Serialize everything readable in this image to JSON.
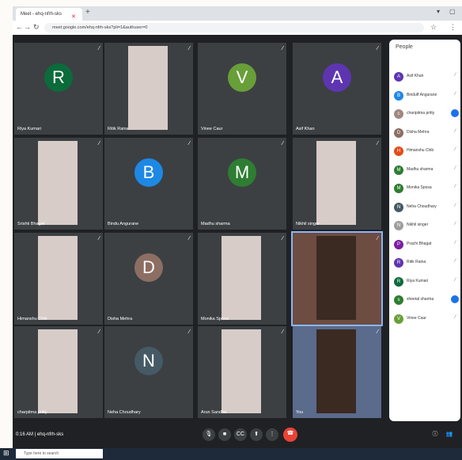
{
  "browser": {
    "tab_title": "Meet - ehq-nfrh-sks",
    "url": "meet.google.com/ehq-nfrh-sks?pli=1&authuser=0"
  },
  "tiles": [
    {
      "name": "Riya Kumari",
      "initial": "R",
      "color": "#0b6b3a"
    },
    {
      "name": "Ritik Raina",
      "initial": "",
      "color": ""
    },
    {
      "name": "Vinee Caur",
      "initial": "V",
      "color": "#689f38"
    },
    {
      "name": "Asif Khan",
      "initial": "A",
      "color": "#5e35b1"
    },
    {
      "name": "Srishti Bhagat",
      "initial": "",
      "color": ""
    },
    {
      "name": "Bindu Angurane",
      "initial": "B",
      "color": "#1e88e5"
    },
    {
      "name": "Madhu sharma",
      "initial": "M",
      "color": "#2e7d32"
    },
    {
      "name": "Nikhil singer",
      "initial": "",
      "color": ""
    },
    {
      "name": "Himanshu Chib",
      "initial": "",
      "color": ""
    },
    {
      "name": "Disha Mehra",
      "initial": "D",
      "color": "#8d6e63"
    },
    {
      "name": "Monika Sposa",
      "initial": "",
      "color": ""
    },
    {
      "name": "",
      "initial": "",
      "color": ""
    },
    {
      "name": "charpitma pritty",
      "initial": "",
      "color": ""
    },
    {
      "name": "Neha Choudhary",
      "initial": "N",
      "color": "#455a64"
    },
    {
      "name": "Arun Sandha",
      "initial": "",
      "color": ""
    },
    {
      "name": "You",
      "initial": "",
      "color": ""
    }
  ],
  "people_panel": {
    "title": "People",
    "participants": [
      {
        "name": "Asif Khan",
        "initial": "A",
        "color": "#5e35b1"
      },
      {
        "name": "Binduff Angurane",
        "initial": "B",
        "color": "#1e88e5"
      },
      {
        "name": "charipitma pritty",
        "initial": "c",
        "color": "#a1887f"
      },
      {
        "name": "Disha Mehra",
        "initial": "D",
        "color": "#8d6e63"
      },
      {
        "name": "Himanshu Chib",
        "initial": "H",
        "color": "#e64a19"
      },
      {
        "name": "Madhu sharma",
        "initial": "M",
        "color": "#2e7d32"
      },
      {
        "name": "Monika Sposa",
        "initial": "M",
        "color": "#2e7d32"
      },
      {
        "name": "Neha Choudhary",
        "initial": "N",
        "color": "#455a64"
      },
      {
        "name": "Nikhil singer",
        "initial": "N",
        "color": "#9e9e9e"
      },
      {
        "name": "Prachi Bhagat",
        "initial": "P",
        "color": "#7b1fa2"
      },
      {
        "name": "Ritik Raina",
        "initial": "R",
        "color": "#5e35b1"
      },
      {
        "name": "Riya Kumari",
        "initial": "R",
        "color": "#0b6b3a"
      },
      {
        "name": "sheetal sharma",
        "initial": "s",
        "color": "#2e7d32"
      },
      {
        "name": "Vinee Caur",
        "initial": "V",
        "color": "#689f38"
      }
    ]
  },
  "bottom_bar": {
    "meeting_info": "0:16 AM | ehq-nfrh-sks"
  },
  "taskbar": {
    "search_placeholder": "Type here to search"
  }
}
